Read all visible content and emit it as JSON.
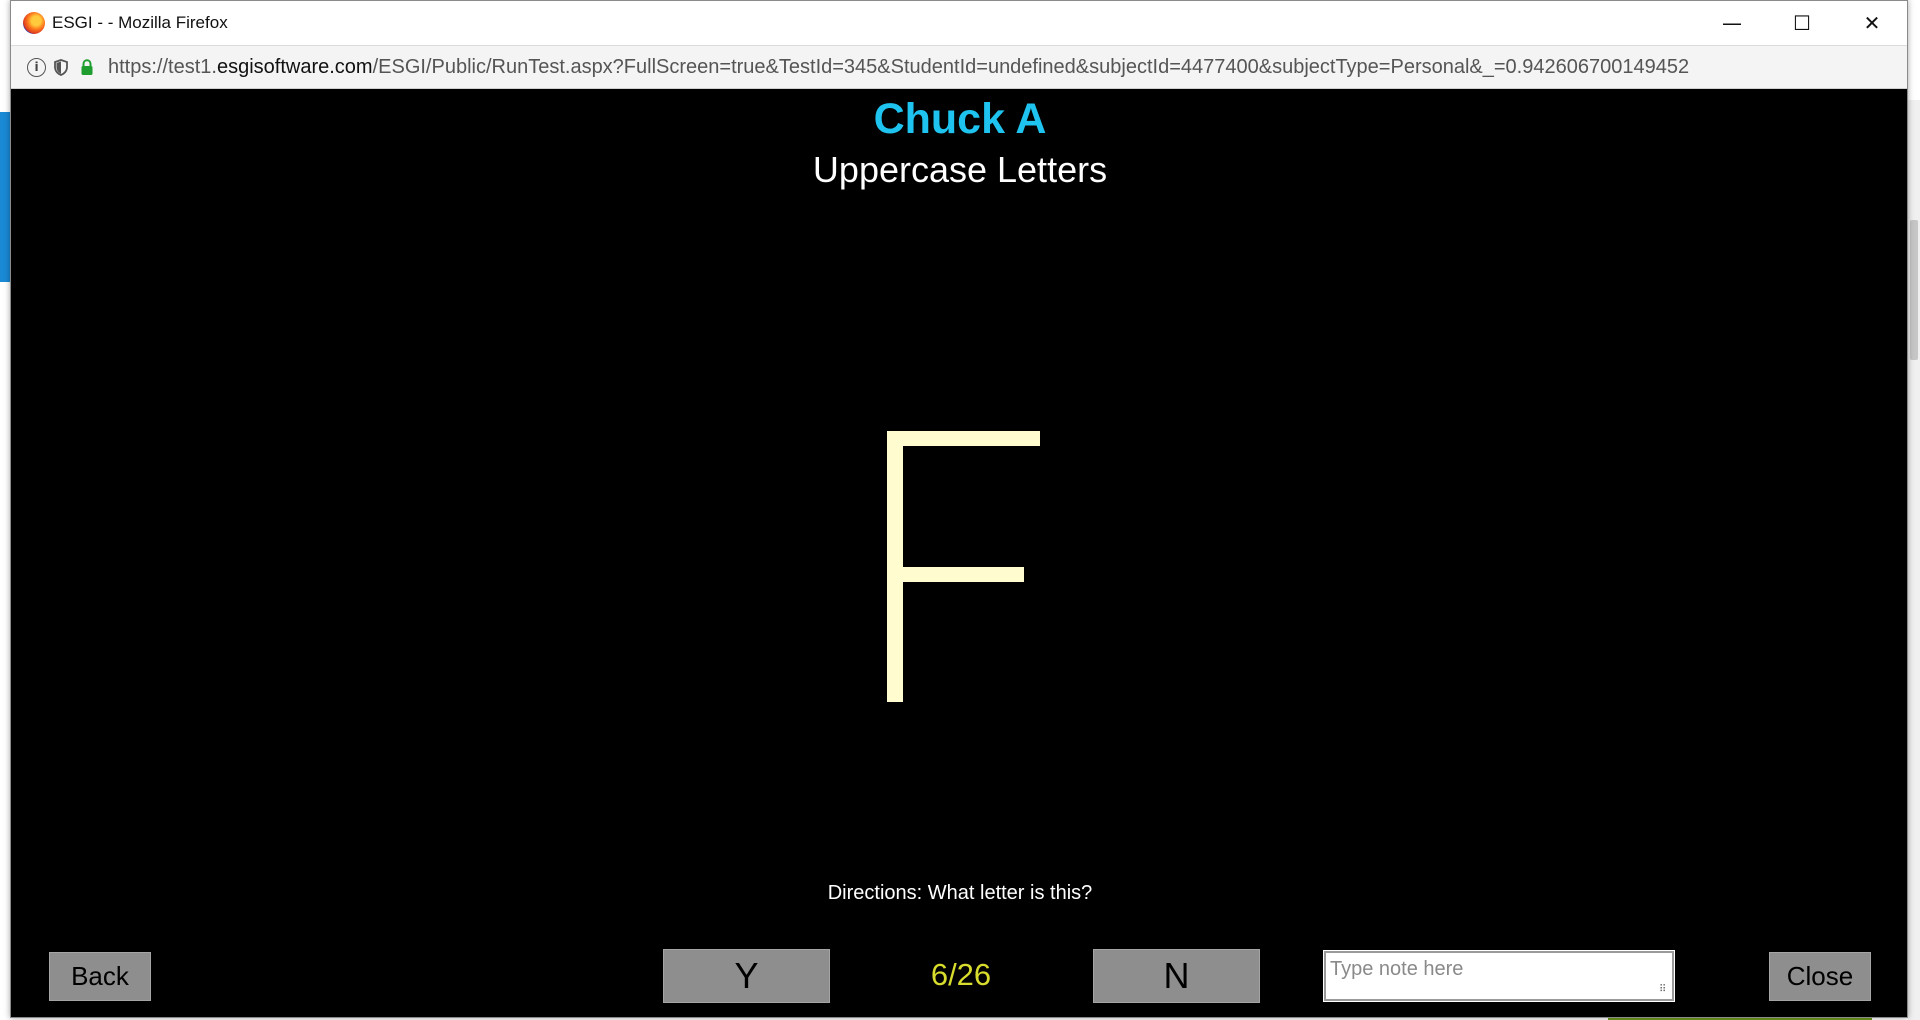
{
  "window": {
    "title": "ESGI - - Mozilla Firefox",
    "controls": {
      "minimize": "—",
      "maximize": "☐",
      "close": "✕"
    }
  },
  "addressbar": {
    "url_prefix": "https://test1.",
    "url_domain": "esgisoftware.com",
    "url_path": "/ESGI/Public/RunTest.aspx?FullScreen=true&TestId=345&StudentId=undefined&subjectId=4477400&subjectType=Personal&_=0.942606700149452",
    "icons": [
      "info-icon",
      "shield-icon",
      "lock-icon"
    ]
  },
  "test": {
    "student_name": "Chuck A",
    "test_name": "Uppercase Letters",
    "question_glyph": "F",
    "directions": "Directions: What letter is this?",
    "progress": "6/26",
    "current_question": 6,
    "total_questions": 26
  },
  "controls": {
    "back_label": "Back",
    "yes_label": "Y",
    "no_label": "N",
    "close_label": "Close",
    "note_placeholder": "Type note here",
    "note_value": ""
  },
  "colors": {
    "student_name": "#1ec4ef",
    "letter": "#fffdd0",
    "progress": "#d8dc2c",
    "button": "#8e8e8e",
    "background": "#000000"
  }
}
